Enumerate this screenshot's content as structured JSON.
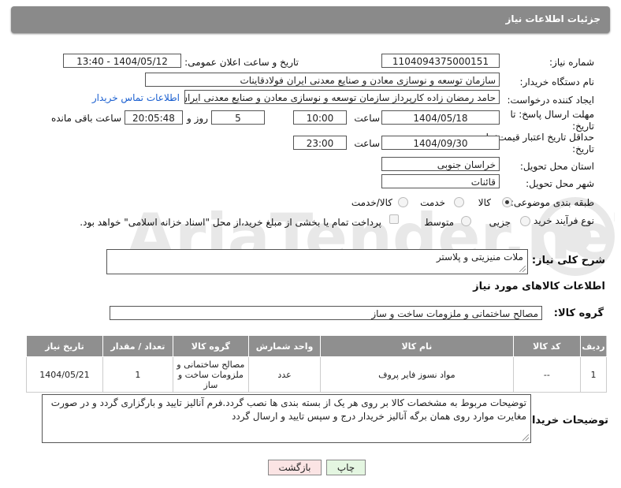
{
  "header": {
    "title": "جزئیات اطلاعات نیاز"
  },
  "form": {
    "need_number_label": "شماره نیاز:",
    "need_number": "1104094375000151",
    "announce_label": "تاریخ و ساعت اعلان عمومی:",
    "announce_value": "1404/05/12 - 13:40",
    "buyer_org_label": "نام دستگاه خریدار:",
    "buyer_org": "سازمان توسعه و نوسازی معادن و صنایع معدنی ایران فولادقاینات",
    "requester_label": "ایجاد کننده درخواست:",
    "requester": "حامد  رمضان زاده  کارپرداز  سازمان توسعه و نوسازی معادن و صنایع معدنی ایران",
    "contact_link": "اطلاعات تماس خریدار",
    "deadline_label": "مهلت ارسال پاسخ: تا تاریخ:",
    "deadline_date": "1404/05/18",
    "time_label": "ساعت",
    "deadline_time": "10:00",
    "days_value": "5",
    "days_label": "روز و",
    "remaining_time": "20:05:48",
    "remaining_label": "ساعت باقی مانده",
    "price_validity_label": "حداقل تاریخ اعتبار قیمت: تا تاریخ:",
    "price_date": "1404/09/30",
    "price_time": "23:00",
    "province_label": "استان محل تحویل:",
    "province": "خراسان جنوبی",
    "city_label": "شهر محل تحویل:",
    "city": "قائنات",
    "category_label": "طبقه بندی موضوعی:",
    "category_options": [
      "کالا",
      "خدمت",
      "کالا/خدمت"
    ],
    "process_label": "نوع فرآیند خرید :",
    "process_options": [
      "جزیی",
      "متوسط"
    ],
    "process_note": "پرداخت تمام یا بخشی از مبلغ خرید،از محل \"اسناد خزانه اسلامی\" خواهد بود."
  },
  "description": {
    "label": "شرح کلی نیاز:",
    "value": "ملات منیزیتی و پلاستر"
  },
  "goods_info": {
    "title": "اطلاعات کالاهای مورد نیاز",
    "group_label": "گروه کالا:",
    "group_value": "مصالح ساختمانی و ملزومات ساخت و ساز"
  },
  "table": {
    "headers": [
      "ردیف",
      "کد کالا",
      "نام کالا",
      "واحد شمارش",
      "گروه کالا",
      "تعداد / مقدار",
      "تاریخ نیاز"
    ],
    "rows": [
      [
        "1",
        "--",
        "مواد نسوز فایر پروف",
        "عدد",
        "مصالح ساختمانی و ملزومات ساخت و ساز",
        "1",
        "1404/05/21"
      ]
    ]
  },
  "buyer_notes": {
    "label": "توضیحات خریدار:",
    "value": "توضیحات مربوط به مشخصات کالا بر روی هر یک از بسته بندی ها نصب گردد.فرم آنالیز تایید و بارگزاری گردد و در صورت مغایرت موارد روی همان برگه آنالیز خریدار درج و سپس تایید و ارسال گردد"
  },
  "buttons": {
    "print": "چاپ",
    "back": "بازگشت"
  },
  "watermark": "AriaTender.neT"
}
